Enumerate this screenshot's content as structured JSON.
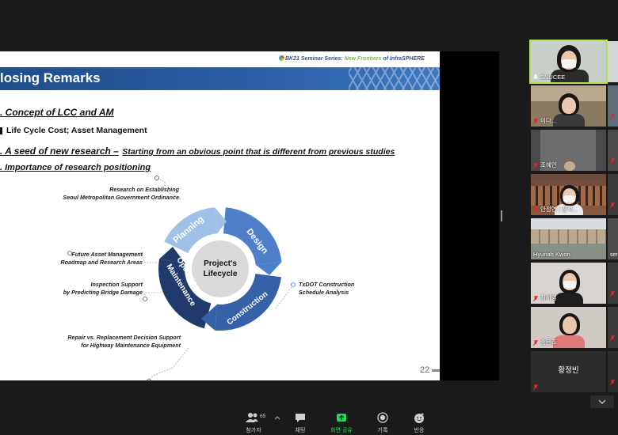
{
  "slide": {
    "series": {
      "prefix": "BK21 Seminar Series: ",
      "highlight": "New Frontiers",
      "middle": " of ",
      "brand": "InfraSPHERE"
    },
    "title": "losing Remarks",
    "sections": [
      {
        "heading": ". Concept of LCC and AM",
        "detail": "Life Cycle Cost; Asset Management"
      },
      {
        "heading": ". A seed of new research –",
        "heading_tail": "Starting from an obvious point that is different from previous studies"
      },
      {
        "heading": ". Importance of research positioning"
      }
    ],
    "diagram": {
      "center": [
        "Project's",
        "Lifecycle"
      ],
      "segments": [
        "Planning",
        "Design",
        "Construction",
        "Operation &",
        "Maintenance"
      ]
    },
    "annotations": {
      "a1": [
        "Research on Establishing",
        "Seoul Metropolitan Government Ordinance"
      ],
      "a2": [
        "Future Asset Management",
        "Roadmap and Research Areas"
      ],
      "a3": [
        "Inspection Support",
        "by Predicting Bridge Damage"
      ],
      "a4": [
        "Repair vs. Replacement Decision Support",
        "for Highway Maintenance Equipment"
      ],
      "a5": [
        "TxDOT Construction",
        "Schedule Analysis"
      ]
    },
    "page_number": "22"
  },
  "participants": {
    "main": [
      {
        "name": "SNUCEE"
      },
      {
        "name": "이다..."
      },
      {
        "name": "조혜인"
      },
      {
        "name": "안정연 | 참석..."
      },
      {
        "name": "Hyunah Kwon"
      },
      {
        "name": "최서영"
      },
      {
        "name": "송은조"
      },
      {
        "name": "황정빈"
      }
    ],
    "right_strip": [
      {
        "name": "sen"
      }
    ]
  },
  "toolbar": {
    "participants_label": "참가자",
    "participants_count": "65",
    "chat_label": "채팅",
    "share_label": "화면 공유",
    "record_label": "기록",
    "reaction_label": "반응"
  },
  "colors": {
    "accent": "#2f5597",
    "share_green": "#23d959",
    "muted_red": "#e02828"
  }
}
